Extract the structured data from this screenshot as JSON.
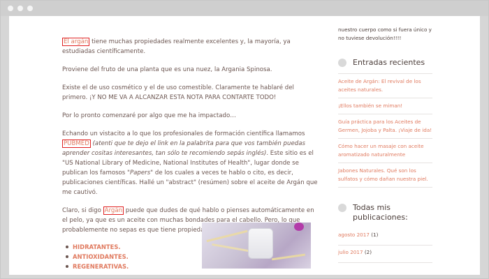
{
  "main": {
    "p1_link": "El argán",
    "p1_text": " tiene muchas propiedades realmente excelentes y, la mayoría, ya estudiadas científicamente.",
    "p2": "Proviene del fruto de una planta que es una nuez, la Argania Spinosa.",
    "p3": "Existe el de uso cosmético y el de uso comestible. Claramente te hablaré del primero. ¡Y NO ME VA A ALCANZAR ESTA NOTA PARA CONTARTE TODO!",
    "p4": "Por lo pronto comenzaré por algo que me ha impactado…",
    "p5_a": "Echando un vistacito a lo que los profesionales de formación científica llamamos ",
    "p5_link": "PUBMED",
    "p5_italic": " (atenti que te dejo el link en la palabrita para que vos también puedas aprender cositas interesantes, tan sólo te recomiendo sepás inglés)",
    "p5_b": ". Este sitio es el \"US National Library of Medicine, National Institutes of Health\", lugar donde se publican los famosos ",
    "p5_papers": "\"Papers\"",
    "p5_c": " de los cuales a veces te hablo o cito, es decir, publicaciones científicas. Hallé un \"abstract\" (resúmen) sobre el aceite de Argán que me cautivó.",
    "p6_a": "Claro, si digo ",
    "p6_link": "Argán",
    "p6_b": " puede que dudes de qué hablo o pienses automáticamente en el pelo, ya que es un aceite con muchas bondades para el cabello. Pero, lo que probablemente no sepas es que tiene propiedades:",
    "bullets": [
      "HIDRATANTES.",
      "ANTIOXIDANTES.",
      "REGENERATIVAS."
    ]
  },
  "sidebar": {
    "top_text": "nuestro cuerpo como si fuera único y no tuviese devolución!!!!",
    "recent_title": "Entradas recientes",
    "recent_posts": [
      "Aceite de Argán: El revival de los aceites naturales.",
      "¡Ellos también se miman!",
      "Guía práctica para los Aceites de Germen, Jojoba y Palta. ¡Viaje de ida!",
      "Cómo hacer un masaje con aceite aromatizado naturalmente",
      "Jabones Naturales. Qué son los sulfatos y cómo dañan nuestra piel."
    ],
    "archive_title": "Todas mis publicaciones:",
    "archives": [
      {
        "label": "agosto 2017",
        "count": "(1)"
      },
      {
        "label": "julio 2017",
        "count": "(2)"
      }
    ]
  },
  "icons": {
    "widget_icon": "circle-icon",
    "window_dots": "window-control-dots"
  },
  "colors": {
    "accent": "#e07a5f",
    "text": "#6b5550",
    "highlight_box": "#e02020"
  }
}
